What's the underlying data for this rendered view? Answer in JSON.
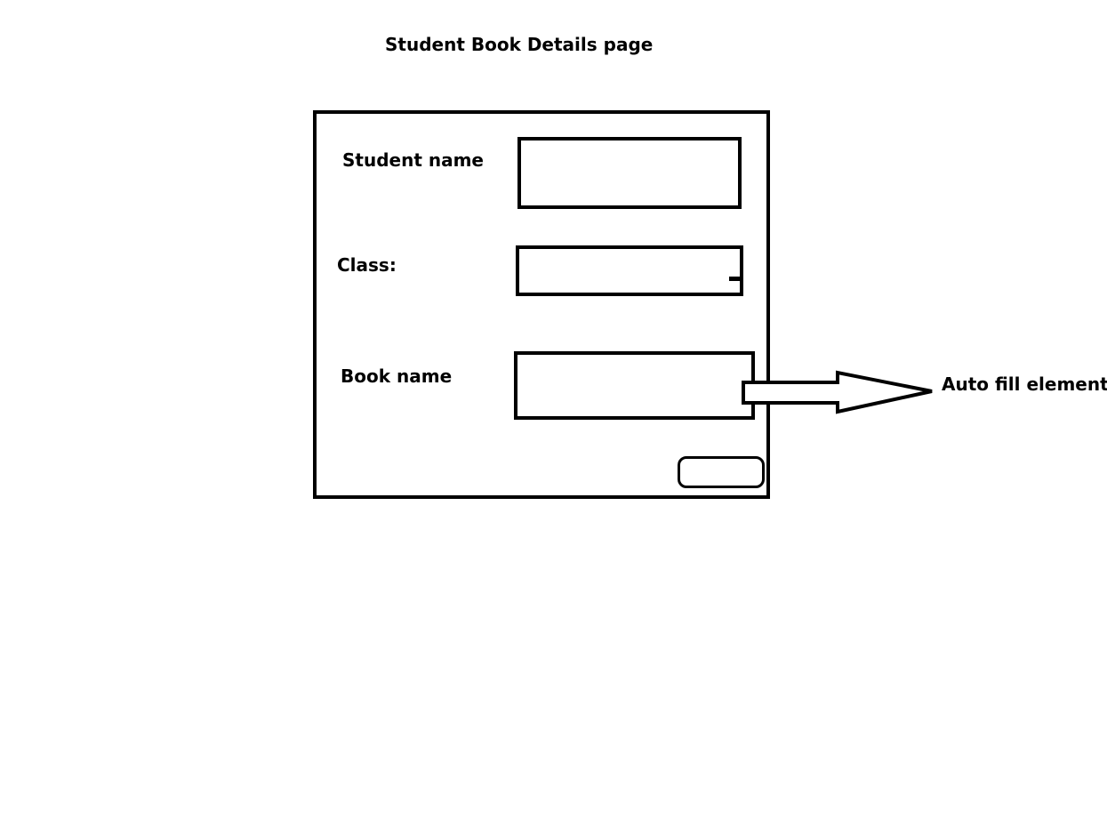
{
  "page": {
    "title": "Student Book Details page"
  },
  "form": {
    "student_name_label": "Student name",
    "student_name_value": "",
    "class_label": "Class:",
    "class_value": "",
    "book_name_label": "Book name",
    "book_name_value": "",
    "submit_label": ""
  },
  "annotation": {
    "callout_text": "Auto fill element"
  }
}
